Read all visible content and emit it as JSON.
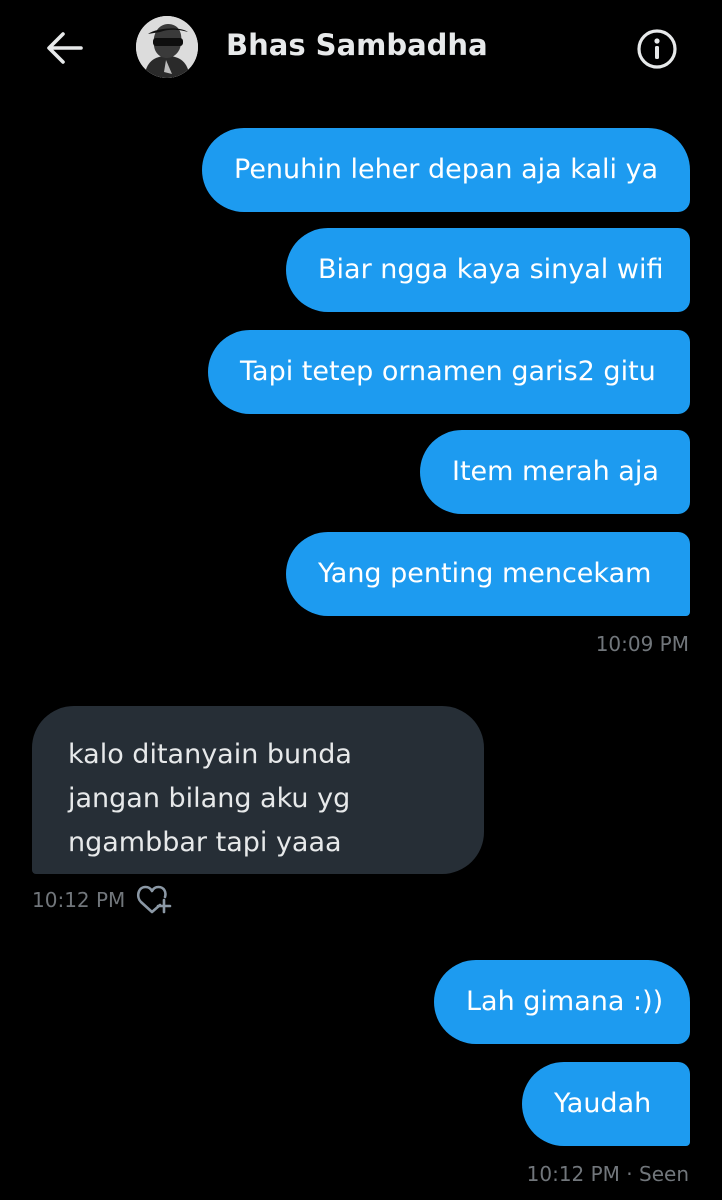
{
  "header": {
    "contact_name": "Bhas Sambadha"
  },
  "conversation": {
    "sent_group_1": [
      "Penuhin leher depan aja kali ya",
      "Biar ngga kaya sinyal wifi",
      "Tapi tetep ornamen garis2 gitu",
      "Item merah aja",
      "Yang penting mencekam"
    ],
    "sent_group_1_time": "10:09 PM",
    "received_message": "kalo ditanyain bunda jangan bilang aku yg ngambbar tapi yaaa",
    "received_time": "10:12 PM",
    "sent_group_2": [
      "Lah gimana :))",
      "Yaudah"
    ],
    "sent_group_2_status": "10:12 PM · Seen"
  },
  "colors": {
    "background": "#000000",
    "sent_bubble": "#1d9bf0",
    "received_bubble": "#262e36",
    "meta_text": "#71767b"
  },
  "icons": {
    "back": "arrow-left-icon",
    "info": "info-icon",
    "react": "heart-plus-icon"
  }
}
